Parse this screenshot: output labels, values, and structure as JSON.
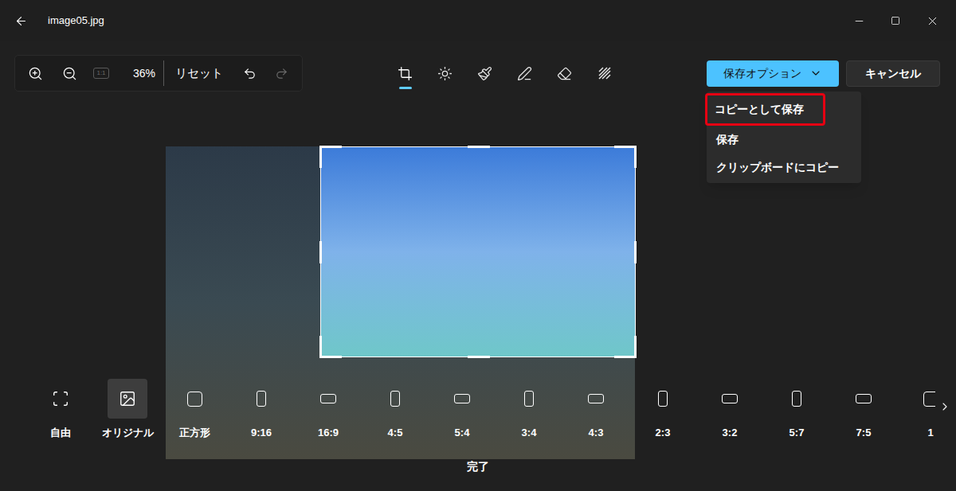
{
  "window": {
    "title": "image05.jpg"
  },
  "zoom": {
    "actual_size": "1:1",
    "actual_size_disabled": true,
    "level_text": "36%",
    "reset": "リセット"
  },
  "history": {
    "undo_disabled": false,
    "redo_disabled": true
  },
  "tools": [
    {
      "kind": "crop",
      "selected": true
    },
    {
      "kind": "adjust",
      "selected": false
    },
    {
      "kind": "filter",
      "selected": false
    },
    {
      "kind": "markup",
      "selected": false
    },
    {
      "kind": "retouch",
      "selected": false
    },
    {
      "kind": "blur",
      "selected": false
    }
  ],
  "save_button": {
    "label": "保存オプション",
    "expanded": true
  },
  "cancel_button": {
    "label": "キャンセル"
  },
  "save_menu": [
    {
      "label": "コピーとして保存",
      "highlighted": true
    },
    {
      "label": "保存",
      "highlighted": false
    },
    {
      "label": "クリップボードにコピー",
      "highlighted": false
    }
  ],
  "aspect_ratios": [
    {
      "label": "自由",
      "kind": "free",
      "selected": false
    },
    {
      "label": "オリジナル",
      "kind": "original",
      "selected": true
    },
    {
      "label": "正方形",
      "kind": "square",
      "selected": false
    },
    {
      "label": "9:16",
      "kind": "portrait",
      "selected": false
    },
    {
      "label": "16:9",
      "kind": "landscape",
      "selected": false
    },
    {
      "label": "4:5",
      "kind": "portrait",
      "selected": false
    },
    {
      "label": "5:4",
      "kind": "landscape",
      "selected": false
    },
    {
      "label": "3:4",
      "kind": "portrait",
      "selected": false
    },
    {
      "label": "4:3",
      "kind": "landscape",
      "selected": false
    },
    {
      "label": "2:3",
      "kind": "portrait",
      "selected": false
    },
    {
      "label": "3:2",
      "kind": "landscape",
      "selected": false
    },
    {
      "label": "5:7",
      "kind": "portrait",
      "selected": false
    },
    {
      "label": "7:5",
      "kind": "landscape",
      "selected": false
    },
    {
      "label": "1",
      "kind": "square",
      "selected": false
    }
  ],
  "done": "完了"
}
